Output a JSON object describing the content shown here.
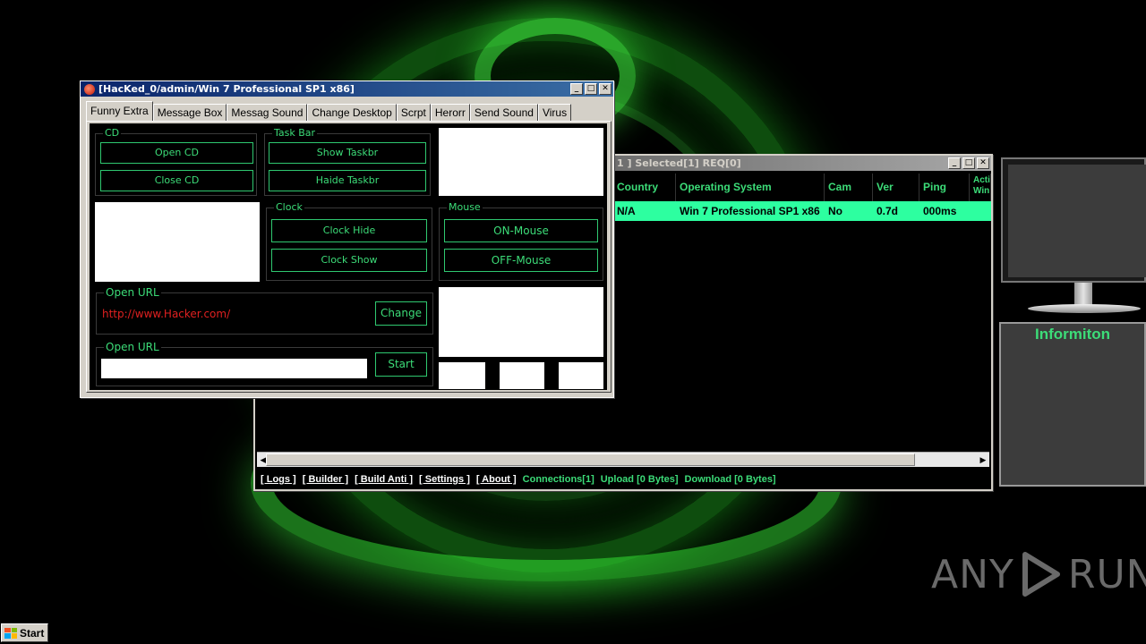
{
  "main_window": {
    "title": "[HacKed_0/admin/Win 7 Professional SP1 x86]",
    "tabs": [
      "Funny Extra",
      "Message Box",
      "Messag Sound",
      "Change Desktop",
      "Scrpt",
      "Herorr",
      "Send Sound",
      "Virus"
    ],
    "selected_tab": "Funny Extra",
    "cd": {
      "label": "CD",
      "open": "Open CD",
      "close": "Close CD"
    },
    "taskbar": {
      "label": "Task Bar",
      "show": "Show Taskbr",
      "hide": "Haide Taskbr"
    },
    "clock": {
      "label": "Clock",
      "hide": "Clock Hide",
      "show": "Clock Show"
    },
    "mouse": {
      "label": "Mouse",
      "on": "ON-Mouse",
      "off": "OFF-Mouse"
    },
    "open_url_1": {
      "label": "Open URL",
      "value": "http://www.Hacker.com/",
      "button": "Change"
    },
    "open_url_2": {
      "label": "Open URL",
      "value": "",
      "button": "Start"
    }
  },
  "clients_window": {
    "title": "1 ]    Selected[1] REQ[0]",
    "columns": [
      "Country",
      "Operating System",
      "Cam",
      "Ver",
      "Ping",
      "Acti Win"
    ],
    "rows": [
      {
        "country": "N/A",
        "os": "Win 7 Professional SP1 x86",
        "cam": "No",
        "ver": "0.7d",
        "ping": "000ms"
      }
    ],
    "links": [
      "[ Logs ]",
      "[ Builder ]",
      "[ Build Anti ]",
      "[ Settings ]",
      "[ About ]"
    ],
    "status": {
      "connections": "Connections[1]",
      "upload": "Upload [0 Bytes]",
      "download": "Download [0 Bytes]"
    }
  },
  "info_panel": {
    "title": "Informiton"
  },
  "watermark": {
    "left": "ANY",
    "right": "RUN"
  },
  "taskbar": {
    "start": "Start"
  },
  "colors": {
    "accent_green": "#3cdc78",
    "row_highlight": "#2dffa0",
    "url_red": "#e02020"
  }
}
